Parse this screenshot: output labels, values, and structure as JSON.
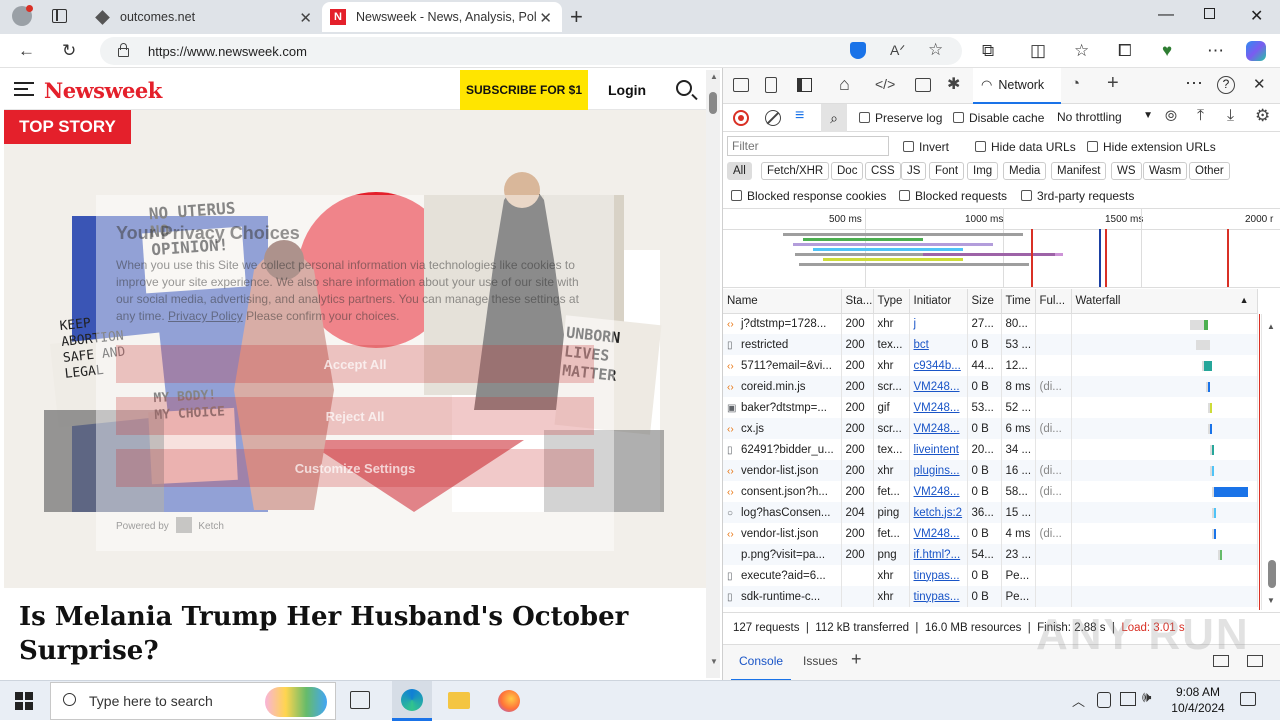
{
  "browser": {
    "tabs": [
      {
        "title": "outcomes.net",
        "favicon": "cube"
      },
      {
        "title": "Newsweek - News, Analysis, Polit",
        "favicon": "N"
      }
    ],
    "url": "https://www.newsweek.com"
  },
  "page": {
    "logo": "Newsweek",
    "subscribe_label": "SUBSCRIBE FOR $1",
    "login_label": "Login",
    "top_story_badge": "TOP STORY",
    "headline": "Is Melania Trump Her Husband's October Surprise?",
    "consent": {
      "title": "Your Privacy Choices",
      "body": "When you use this Site we collect personal information via technologies like cookies to improve your site experience. We also share information about your use of our site with our social media, advertising, and analytics partners. You can manage these settings at any time.",
      "policy_link": "Privacy Policy",
      "confirm_text": "Please confirm your choices.",
      "accept_label": "Accept All",
      "reject_label": "Reject All",
      "customize_label": "Customize Settings",
      "powered_by": "Powered by",
      "vendor": "Ketch"
    },
    "signs": [
      "NO UTERUS NO OPINION!",
      "KEEP ABORTION SAFE AND LEGAL",
      "MY BODY! MY CHOICE",
      "UNBORN LIVES MATTER"
    ]
  },
  "devtools": {
    "active_panel": "Network",
    "preserve_log": "Preserve log",
    "disable_cache": "Disable cache",
    "throttling": "No throttling",
    "filter_placeholder": "Filter",
    "invert": "Invert",
    "hide_data_urls": "Hide data URLs",
    "hide_extension_urls": "Hide extension URLs",
    "type_filters": [
      "All",
      "Fetch/XHR",
      "Doc",
      "CSS",
      "JS",
      "Font",
      "Img",
      "Media",
      "Manifest",
      "WS",
      "Wasm",
      "Other"
    ],
    "blocked_response_cookies": "Blocked response cookies",
    "blocked_requests": "Blocked requests",
    "third_party": "3rd-party requests",
    "timeline_ticks": [
      "500 ms",
      "1000 ms",
      "1500 ms",
      "2000 r"
    ],
    "columns": [
      "Name",
      "Sta...",
      "Type",
      "Initiator",
      "Size",
      "Time",
      "Ful...",
      "Waterfall"
    ],
    "requests": [
      {
        "name": "j?dtstmp=1728...",
        "status": "200",
        "type": "xhr",
        "initiator": "j",
        "size": "27...",
        "time": "80...",
        "full": "",
        "icon": "code"
      },
      {
        "name": "restricted",
        "status": "200",
        "type": "tex...",
        "initiator": "bct",
        "size": "0 B",
        "time": "53 ...",
        "full": "",
        "icon": "doc"
      },
      {
        "name": "5711?email=&vi...",
        "status": "200",
        "type": "xhr",
        "initiator": "c9344b...",
        "size": "44...",
        "time": "12...",
        "full": "",
        "icon": "code"
      },
      {
        "name": "coreid.min.js",
        "status": "200",
        "type": "scr...",
        "initiator": "VM248...",
        "size": "0 B",
        "time": "8 ms",
        "full": "(di...",
        "icon": "code"
      },
      {
        "name": "baker?dtstmp=...",
        "status": "200",
        "type": "gif",
        "initiator": "VM248...",
        "size": "53...",
        "time": "52 ...",
        "full": "",
        "icon": "img"
      },
      {
        "name": "cx.js",
        "status": "200",
        "type": "scr...",
        "initiator": "VM248...",
        "size": "0 B",
        "time": "6 ms",
        "full": "(di...",
        "icon": "code"
      },
      {
        "name": "62491?bidder_u...",
        "status": "200",
        "type": "tex...",
        "initiator": "liveintent",
        "size": "20...",
        "time": "34 ...",
        "full": "",
        "icon": "doc"
      },
      {
        "name": "vendor-list.json",
        "status": "200",
        "type": "xhr",
        "initiator": "plugins...",
        "size": "0 B",
        "time": "16 ...",
        "full": "(di...",
        "icon": "code"
      },
      {
        "name": "consent.json?h...",
        "status": "200",
        "type": "fet...",
        "initiator": "VM248...",
        "size": "0 B",
        "time": "58...",
        "full": "(di...",
        "icon": "code"
      },
      {
        "name": "log?hasConsen...",
        "status": "204",
        "type": "ping",
        "initiator": "ketch.js:2",
        "size": "36...",
        "time": "15 ...",
        "full": "",
        "icon": "ping"
      },
      {
        "name": "vendor-list.json",
        "status": "200",
        "type": "fet...",
        "initiator": "VM248...",
        "size": "0 B",
        "time": "4 ms",
        "full": "(di...",
        "icon": "code"
      },
      {
        "name": "p.png?visit=pa...",
        "status": "200",
        "type": "png",
        "initiator": "if.html?...",
        "size": "54...",
        "time": "23 ...",
        "full": "",
        "icon": "none"
      },
      {
        "name": "execute?aid=6...",
        "status": "",
        "type": "xhr",
        "initiator": "tinypas...",
        "size": "0 B",
        "time": "Pe...",
        "full": "",
        "icon": "doc"
      },
      {
        "name": "sdk-runtime-c...",
        "status": "",
        "type": "xhr",
        "initiator": "tinypas...",
        "size": "0 B",
        "time": "Pe...",
        "full": "",
        "icon": "doc"
      }
    ],
    "summary": {
      "requests": "127 requests",
      "transferred": "112 kB transferred",
      "resources": "16.0 MB resources",
      "finish": "Finish: 2.88 s",
      "load": "Load: 3.01 s"
    },
    "drawer_tabs": [
      "Console",
      "Issues"
    ]
  },
  "taskbar": {
    "search_placeholder": "Type here to search",
    "time": "9:08 AM",
    "date": "10/4/2024"
  },
  "watermark": "ANY RUN",
  "colors": {
    "newsweek_red": "#e4202b",
    "subscribe_yellow": "#ffe500",
    "link_blue": "#1a55c7",
    "load_red": "#d93025"
  }
}
